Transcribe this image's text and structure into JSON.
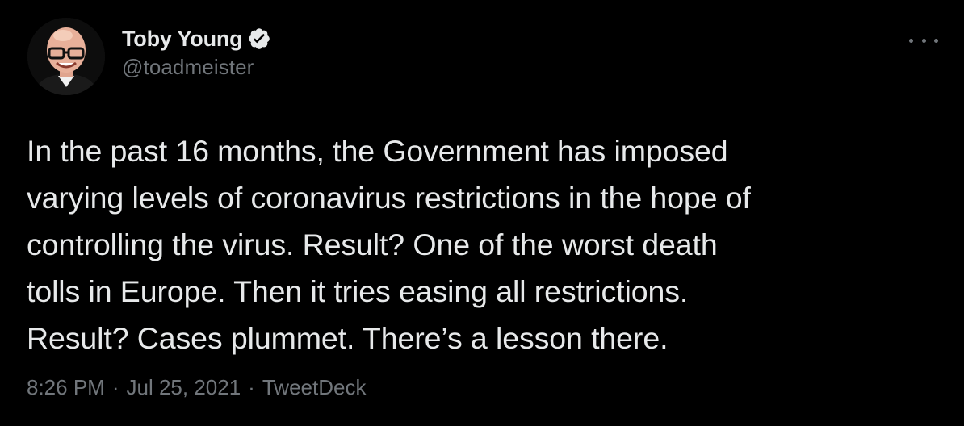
{
  "author": {
    "display_name": "Toby Young",
    "handle": "@toadmeister",
    "verified": true,
    "avatar": "profile-photo"
  },
  "more_icon": "more-options-icon",
  "tweet": {
    "text": "In the past 16 months, the Government has imposed\nvarying levels of coronavirus restrictions in the hope of\ncontrolling the virus. Result? One of the worst death\ntolls in Europe. Then it tries easing all restrictions.\nResult? Cases plummet. There’s a lesson there.",
    "time": "8:26 PM",
    "separator": "·",
    "date": "Jul 25, 2021",
    "source": "TweetDeck"
  },
  "colors": {
    "background": "#000000",
    "text": "#e7e9ea",
    "secondary": "#71767b",
    "verified_badge": "#e7e9ea"
  }
}
